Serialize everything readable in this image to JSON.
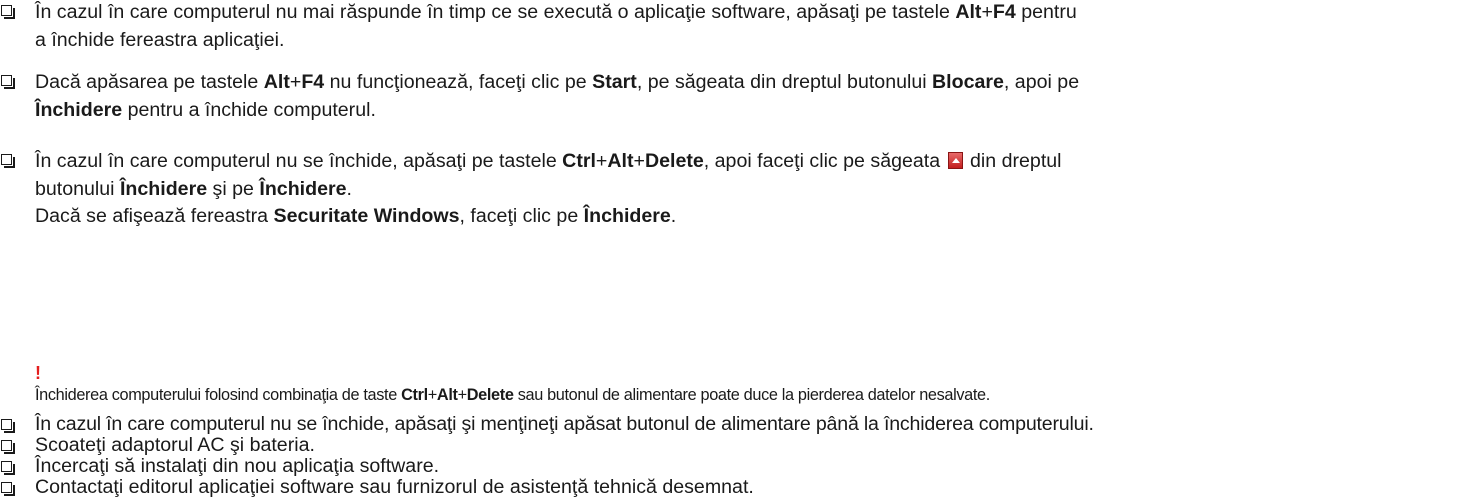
{
  "items": [
    {
      "line1": [
        {
          "t": "În cazul în care computerul nu mai răspunde în timp ce se execută o aplicaţie software, apăsaţi pe tastele "
        },
        {
          "t": "Alt",
          "b": true
        },
        {
          "t": "+"
        },
        {
          "t": "F4",
          "b": true
        },
        {
          "t": " pentru"
        }
      ],
      "line2": [
        {
          "t": "a închide fereastra aplicaţiei."
        }
      ]
    },
    {
      "line1": [
        {
          "t": "Dacă apăsarea pe tastele "
        },
        {
          "t": "Alt",
          "b": true
        },
        {
          "t": "+"
        },
        {
          "t": "F4",
          "b": true
        },
        {
          "t": " nu funcţionează, faceţi clic pe "
        },
        {
          "t": "Start",
          "b": true
        },
        {
          "t": ", pe săgeata din dreptul butonului "
        },
        {
          "t": "Blocare",
          "b": true
        },
        {
          "t": ", apoi pe"
        }
      ],
      "line2": [
        {
          "t": "Închidere",
          "b": true
        },
        {
          "t": " pentru a închide computerul."
        }
      ]
    },
    {
      "line1a": [
        {
          "t": "În cazul în care computerul nu se închide, apăsaţi pe tastele "
        },
        {
          "t": "Ctrl",
          "b": true
        },
        {
          "t": "+"
        },
        {
          "t": "Alt",
          "b": true
        },
        {
          "t": "+"
        },
        {
          "t": "Delete",
          "b": true
        },
        {
          "t": ", apoi faceţi clic pe săgeata "
        }
      ],
      "line1b": [
        {
          "t": " din dreptul"
        }
      ],
      "line2": [
        {
          "t": "butonului "
        },
        {
          "t": "Închidere",
          "b": true
        },
        {
          "t": " şi pe "
        },
        {
          "t": "Închidere",
          "b": true
        },
        {
          "t": "."
        }
      ],
      "line3": [
        {
          "t": "Dacă se afişează fereastra "
        },
        {
          "t": "Securitate Windows",
          "b": true
        },
        {
          "t": ", faceţi clic pe "
        },
        {
          "t": "Închidere",
          "b": true
        },
        {
          "t": "."
        }
      ]
    }
  ],
  "warning": {
    "mark": "!",
    "text": [
      {
        "t": "Închiderea computerului folosind combinaţia de taste "
      },
      {
        "t": "Ctrl",
        "b": true
      },
      {
        "t": "+"
      },
      {
        "t": "Alt",
        "b": true
      },
      {
        "t": "+"
      },
      {
        "t": "Delete",
        "b": true
      },
      {
        "t": " sau butonul de alimentare poate duce la pierderea datelor nesalvate."
      }
    ]
  },
  "simple_items": [
    "În cazul în care computerul nu se închide, apăsaţi şi menţineţi apăsat butonul de alimentare până la închiderea computerului.",
    "Scoateţi adaptorul AC şi bateria.",
    "Încercaţi să instalaţi din nou aplicaţia software.",
    "Contactaţi editorul aplicaţiei software sau furnizorul de asistenţă tehnică desemnat."
  ],
  "icons": {
    "bullet": "checkbox-bullet-icon",
    "arrow": "red-up-arrow-button-icon",
    "warning": "exclamation-warning-icon"
  }
}
